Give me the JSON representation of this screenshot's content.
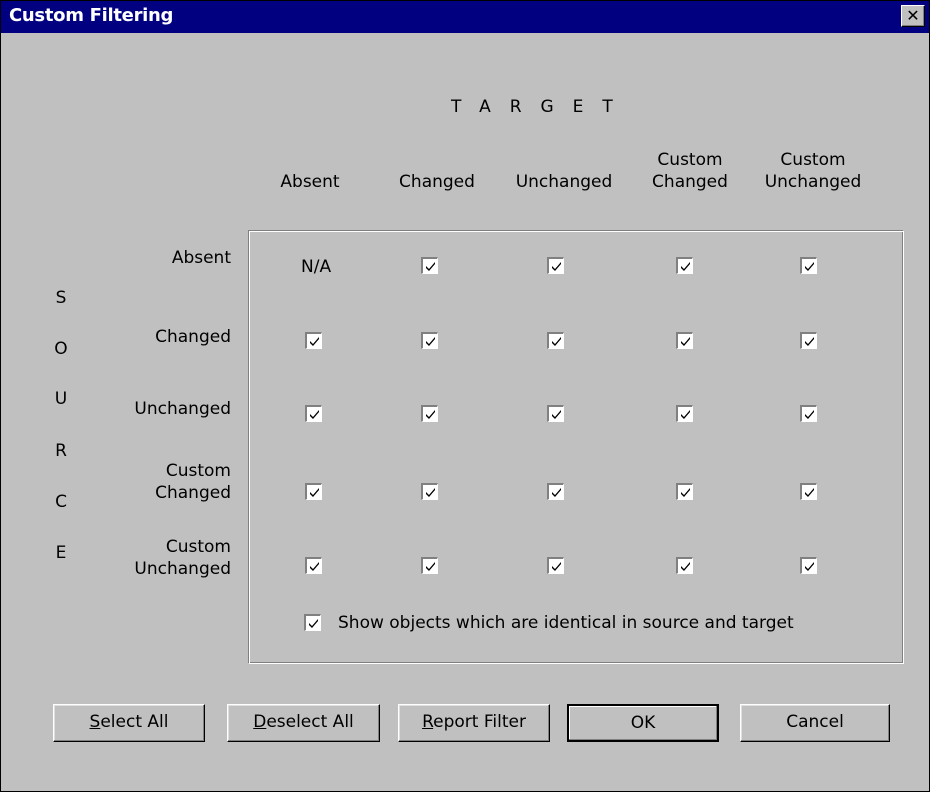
{
  "window": {
    "title": "Custom Filtering",
    "close_icon": "close-icon"
  },
  "target_label": "TARGET",
  "source_letters": [
    "S",
    "O",
    "U",
    "R",
    "C",
    "E"
  ],
  "columns": [
    {
      "line1": "",
      "line2": "Absent"
    },
    {
      "line1": "",
      "line2": "Changed"
    },
    {
      "line1": "",
      "line2": "Unchanged"
    },
    {
      "line1": "Custom",
      "line2": "Changed"
    },
    {
      "line1": "Custom",
      "line2": "Unchanged"
    }
  ],
  "rows": [
    {
      "line1": "",
      "line2": "Absent"
    },
    {
      "line1": "",
      "line2": "Changed"
    },
    {
      "line1": "",
      "line2": "Unchanged"
    },
    {
      "line1": "Custom",
      "line2": "Changed"
    },
    {
      "line1": "Custom",
      "line2": "Unchanged"
    }
  ],
  "na_text": "N/A",
  "matrix_checked": [
    [
      null,
      true,
      true,
      true,
      true
    ],
    [
      true,
      true,
      true,
      true,
      true
    ],
    [
      true,
      true,
      true,
      true,
      true
    ],
    [
      true,
      true,
      true,
      true,
      true
    ],
    [
      true,
      true,
      true,
      true,
      true
    ]
  ],
  "identical": {
    "checked": true,
    "label": "Show objects which are identical in source and target"
  },
  "buttons": {
    "select_all": {
      "mnemonic": "S",
      "rest": "elect All"
    },
    "deselect_all": {
      "mnemonic": "D",
      "rest": "eselect All"
    },
    "report_filter": {
      "mnemonic": "R",
      "rest": "eport Filter"
    },
    "ok": "OK",
    "cancel": "Cancel"
  }
}
